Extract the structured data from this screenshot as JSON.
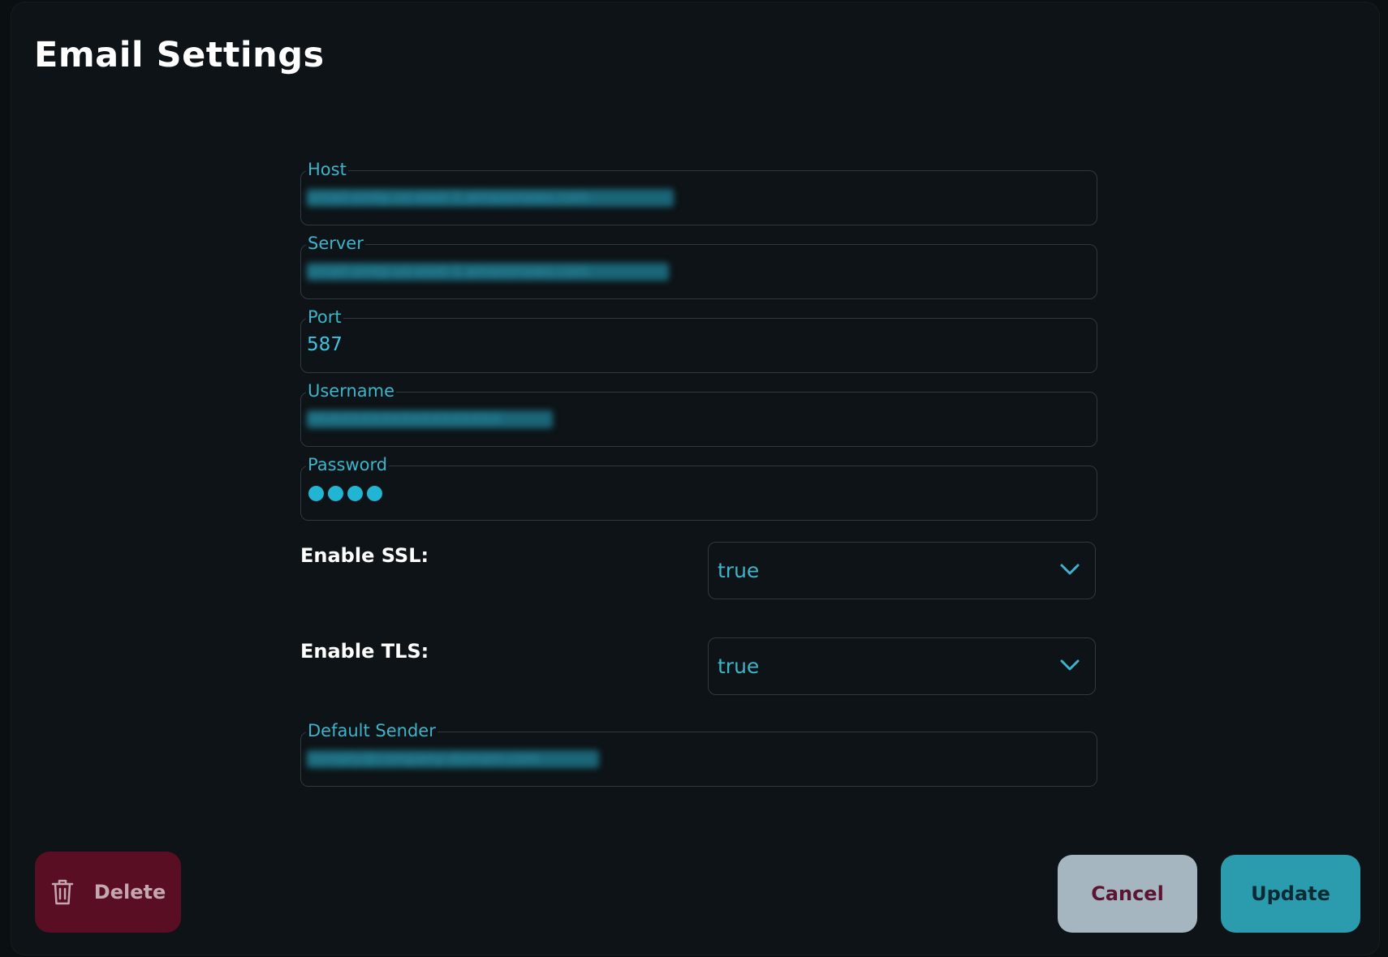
{
  "dialog": {
    "title": "Email Settings"
  },
  "fields": {
    "host": {
      "label": "Host",
      "value": "email-smtp.us-east-1.amazonaws.com"
    },
    "server": {
      "label": "Server",
      "value": "email-smtp.us-east-1.amazonaws.com"
    },
    "port": {
      "label": "Port",
      "value": "587"
    },
    "username": {
      "label": "Username",
      "value": "AKIAXXXXXXXXXXXXXXXX"
    },
    "password": {
      "label": "Password",
      "masked_length": 4
    },
    "default_sender": {
      "label": "Default Sender",
      "value": "noreply@company-domain.com"
    }
  },
  "toggles": {
    "ssl": {
      "label": "Enable SSL:",
      "value": "true"
    },
    "tls": {
      "label": "Enable TLS:",
      "value": "true"
    }
  },
  "buttons": {
    "delete": "Delete",
    "cancel": "Cancel",
    "update": "Update"
  },
  "colors": {
    "accent": "#3fb3c9",
    "delete_bg": "#5a0e23",
    "cancel_bg": "#a5b6c0",
    "update_bg": "#2b9cae",
    "modal_bg": "#0d1316"
  },
  "icons": {
    "delete": "trash-icon",
    "select": "chevron-down-icon"
  }
}
